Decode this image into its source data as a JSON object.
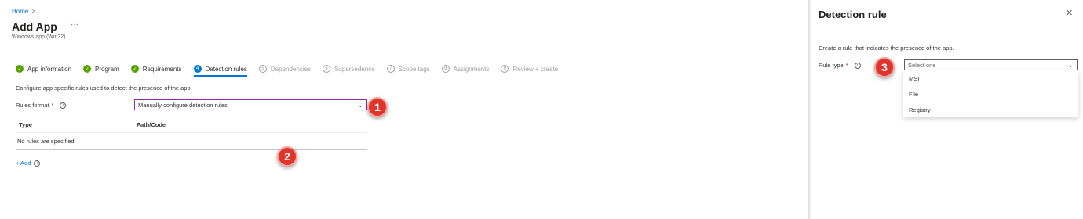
{
  "breadcrumb": {
    "home": "Home",
    "separator": ">"
  },
  "page": {
    "title": "Add App",
    "more": "···",
    "subtitle": "Windows app (Win32)"
  },
  "wizard": {
    "steps": [
      {
        "num": "✓",
        "label": "App information",
        "state": "done"
      },
      {
        "num": "✓",
        "label": "Program",
        "state": "done"
      },
      {
        "num": "✓",
        "label": "Requirements",
        "state": "done"
      },
      {
        "num": "4",
        "label": "Detection rules",
        "state": "active"
      },
      {
        "num": "5",
        "label": "Dependencies",
        "state": "pending"
      },
      {
        "num": "6",
        "label": "Supersedence",
        "state": "pending"
      },
      {
        "num": "7",
        "label": "Scope tags",
        "state": "pending"
      },
      {
        "num": "8",
        "label": "Assignments",
        "state": "pending"
      },
      {
        "num": "9",
        "label": "Review + create",
        "state": "pending"
      }
    ]
  },
  "main": {
    "description": "Configure app specific rules used to detect the presence of the app.",
    "rules_format_label": "Rules format",
    "required_mark": "*",
    "info_glyph": "i",
    "rules_format_value": "Manually configure detection rules",
    "table": {
      "col_type": "Type",
      "col_path": "Path/Code",
      "empty": "No rules are specified."
    },
    "add_label": "+ Add"
  },
  "callouts": [
    "1",
    "2",
    "3"
  ],
  "panel": {
    "title": "Detection rule",
    "close": "✕",
    "description": "Create a rule that indicates the presence of the app.",
    "rule_type_label": "Rule type",
    "rule_type_placeholder": "Select one",
    "options": [
      "MSI",
      "File",
      "Registry"
    ]
  },
  "colors": {
    "accent": "#0078d4",
    "done": "#57a300",
    "callout": "#e0352b",
    "focus_border": "#8a2da5"
  }
}
